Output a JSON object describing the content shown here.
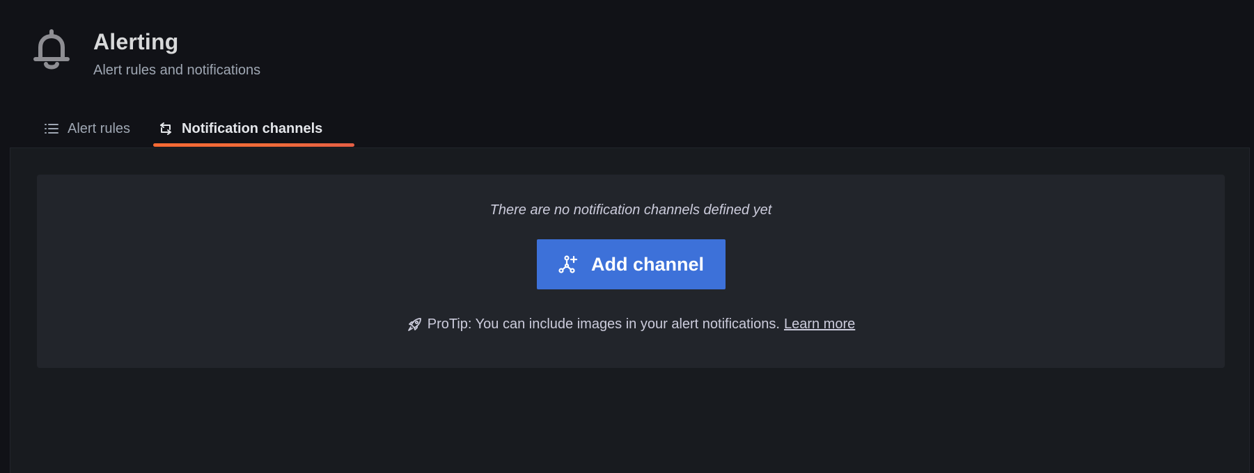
{
  "header": {
    "icon": "bell-icon",
    "title": "Alerting",
    "subtitle": "Alert rules and notifications"
  },
  "tabs": [
    {
      "label": "Alert rules",
      "icon": "list-icon",
      "active": false
    },
    {
      "label": "Notification channels",
      "icon": "channels-icon",
      "active": true
    }
  ],
  "colors": {
    "background": "#111217",
    "panel": "#181b1f",
    "card": "#22252b",
    "primary_button": "#3d71d9",
    "active_tab_accent": "#f66a34"
  },
  "empty_state": {
    "message": "There are no notification channels defined yet",
    "button_label": "Add channel",
    "button_icon": "channel-add-icon",
    "protip_icon": "rocket-icon",
    "protip_text": "ProTip: You can include images in your alert notifications.",
    "protip_link": "Learn more"
  }
}
